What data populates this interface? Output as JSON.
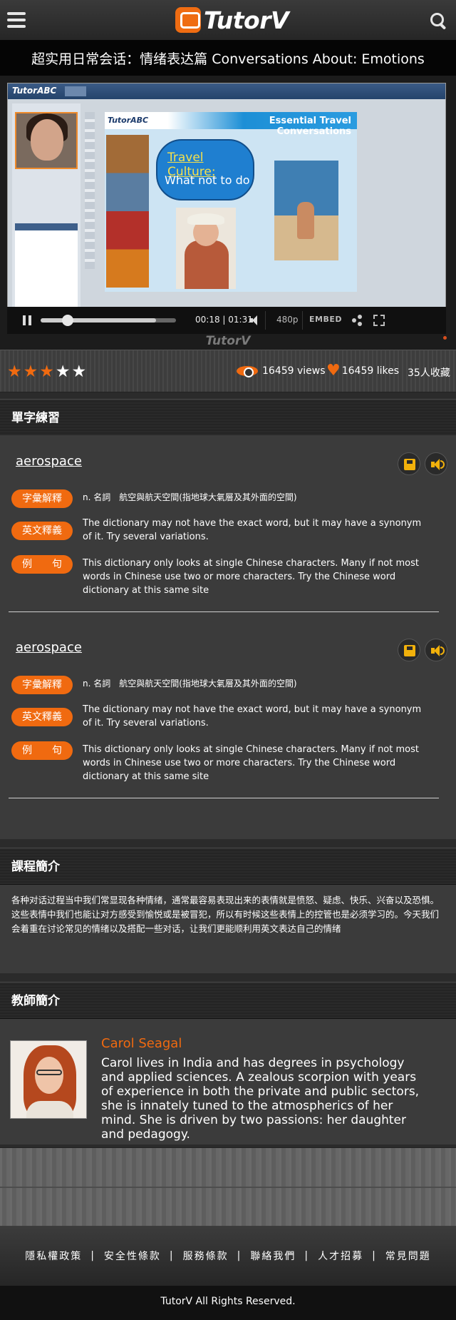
{
  "header": {
    "logo_text": "TutorV",
    "page_title": "超实用日常会话：情绪表达篇 Conversations About: Emotions"
  },
  "video": {
    "app_brand": "TutorABC",
    "slide_brand": "TutorABC",
    "slide_title": "Essential Travel Conversations",
    "bubble_line1": "Travel Culture:",
    "bubble_line2": "What not to do",
    "time": "00:18 | 01:31",
    "progress_fraction": 0.2,
    "buffered_fraction": 0.85,
    "quality": "480p",
    "embed_label": "EMBED",
    "watermark": "TutorV"
  },
  "stats": {
    "rating": 3,
    "rating_max": 5,
    "views": "16459 views",
    "likes": "16459 likes",
    "favorites": "35人收藏"
  },
  "vocab": {
    "section_title": "單字練習",
    "entries": [
      {
        "word": "aerospace",
        "label_definition": "字彙解釋",
        "definition": "n. 名詞　航空與航天空間(指地球大氣層及其外面的空間)",
        "label_english": "英文釋義",
        "english": "The dictionary may not have the exact word, but it may have a synonym of it. Try several variations.",
        "label_example": "例　　句",
        "example": "This dictionary only looks at single Chinese characters. Many if not most words in Chinese use two or more characters. Try the Chinese word dictionary at this same site"
      },
      {
        "word": "aerospace",
        "label_definition": "字彙解釋",
        "definition": "n. 名詞　航空與航天空間(指地球大氣層及其外面的空間)",
        "label_english": "英文釋義",
        "english": "The dictionary may not have the exact word, but it may have a synonym of it. Try several variations.",
        "label_example": "例　　句",
        "example": "This dictionary only looks at single Chinese characters. Many if not most words in Chinese use two or more characters. Try the Chinese word dictionary at this same site"
      }
    ]
  },
  "course": {
    "section_title": "課程簡介",
    "description": "各种对话过程当中我们常显现各种情绪，通常最容易表现出来的表情就是愤怒、疑虑、快乐、兴奋以及恐惧。这些表情中我们也能让对方感受到愉悦或是被冒犯，所以有时候这些表情上的控管也是必须学习的。今天我们会着重在讨论常见的情绪以及搭配一些对话，让我们更能顺利用英文表达自己的情绪"
  },
  "teacher": {
    "section_title": "教師簡介",
    "name": "Carol Seagal",
    "bio": "Carol lives in India and has degrees in psychology and applied sciences. A zealous scorpion with years of experience in both the private and public sectors, she is innately tuned to the atmospherics of her mind. She is driven by two passions: her daughter and pedagogy."
  },
  "footer": {
    "links": [
      "隱私權政策",
      "安全性條款",
      "服務條款",
      "聯絡我們",
      "人才招募",
      "常見問題"
    ],
    "copyright": "TutorV All Rights Reserved."
  },
  "colors": {
    "accent": "#f06a10",
    "icon_gold": "#f2b10b",
    "background": "#3b3b3b"
  }
}
